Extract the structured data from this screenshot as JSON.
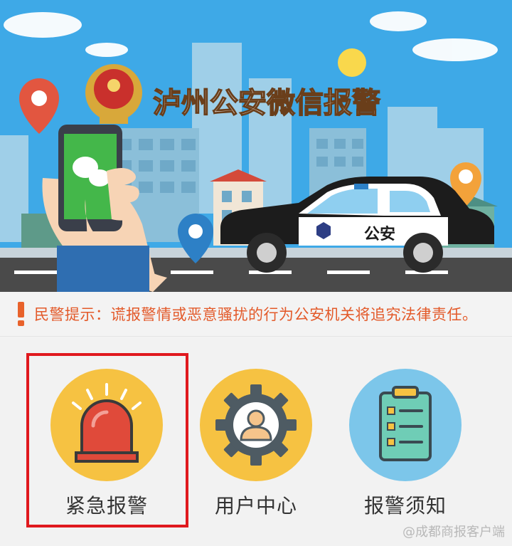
{
  "banner": {
    "title": "泸州公安微信报警",
    "car_text": "公安"
  },
  "notice": {
    "icon": "exclamation-icon",
    "text": "民警提示：谎报警情或恶意骚扰的行为公安机关将追究法律责任。"
  },
  "menu": {
    "items": [
      {
        "label": "紧急报警",
        "icon": "siren-icon",
        "color": "#f6c242",
        "selected": true
      },
      {
        "label": "用户中心",
        "icon": "gear-user-icon",
        "color": "#f6c242"
      },
      {
        "label": "报警须知",
        "icon": "clipboard-icon",
        "color": "#7cc6ea"
      }
    ]
  },
  "highlight_color": "#e0191e",
  "watermark": "@成都商报客户端"
}
